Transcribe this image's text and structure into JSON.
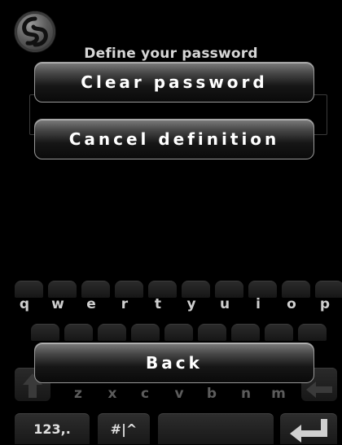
{
  "screen": {
    "title": "Define your password"
  },
  "buttons": {
    "clear_password": "Clear password",
    "cancel_definition": "Cancel definition",
    "back": "Back"
  },
  "keyboard": {
    "row1": [
      "q",
      "w",
      "e",
      "r",
      "t",
      "y",
      "u",
      "i",
      "o",
      "p"
    ],
    "row3": [
      "z",
      "x",
      "c",
      "v",
      "b",
      "n",
      "m"
    ],
    "numbers_key": "123,.",
    "symbols_key": "#|^",
    "icons": [
      "shift-icon",
      "enter-icon",
      "backspace-icon"
    ]
  }
}
